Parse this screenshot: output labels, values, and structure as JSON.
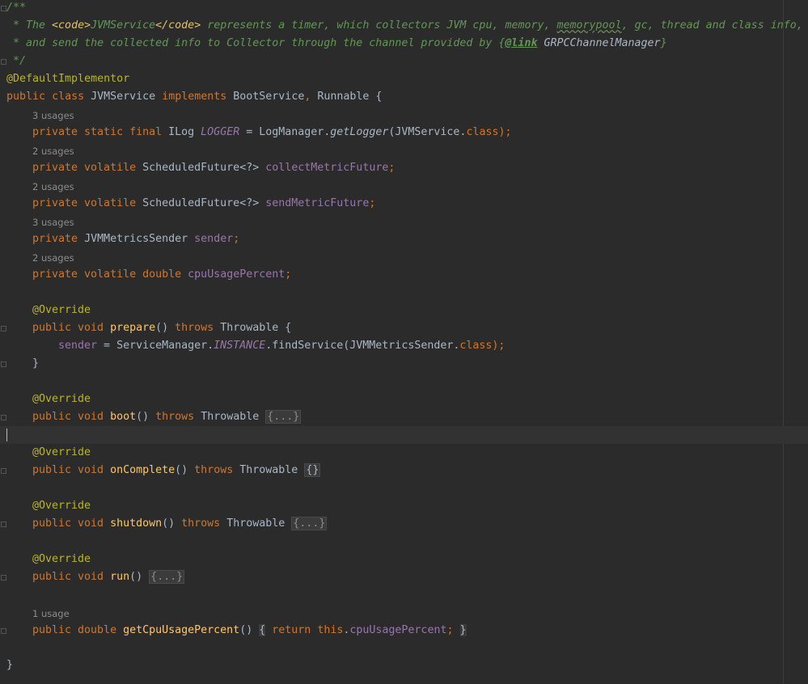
{
  "editor": {
    "comment": {
      "open": "/**",
      "line1_prefix": " * The ",
      "line1_code_open": "<code>",
      "line1_code_text": "JVMService",
      "line1_code_close": "</code>",
      "line1_rest_a": " represents a timer, which collectors JVM cpu, memory, ",
      "line1_typo": "memorypool",
      "line1_rest_b": ", gc, thread and class info,",
      "line2_prefix": " * and send the collected info to Collector through the channel provided by {",
      "line2_tag": "@link",
      "line2_ref": " GRPCChannelManager",
      "line2_suffix": "}",
      "close": " */"
    },
    "annotation_default": "@DefaultImplementor",
    "class_decl": {
      "kw1": "public",
      "kw2": "class",
      "name": "JVMService",
      "kw3": "implements",
      "iface1": "BootService",
      "comma": ",",
      "iface2": "Runnable",
      "brace": " {"
    },
    "fields": [
      {
        "hint": "3 usages",
        "kw": "private static final",
        "type": "ILog",
        "name": "LOGGER",
        "rest_a": " = LogManager.",
        "call": "getLogger",
        "rest_b": "(JVMService.",
        "cls": "class",
        "rest_c": ");"
      },
      {
        "hint": "2 usages",
        "kw": "private volatile",
        "type": "ScheduledFuture<?>",
        "name": "collectMetricFuture",
        "semi": ";"
      },
      {
        "hint": "2 usages",
        "kw": "private volatile",
        "type": "ScheduledFuture<?>",
        "name": "sendMetricFuture",
        "semi": ";"
      },
      {
        "hint": "3 usages",
        "kw": "private",
        "type": "JVMMetricsSender",
        "name": "sender",
        "semi": ";"
      },
      {
        "hint": "2 usages",
        "kw": "private volatile",
        "type": "double",
        "name": "cpuUsagePercent",
        "semi": ";"
      }
    ],
    "override": "@Override",
    "prepare": {
      "kw": "public void",
      "name": "prepare",
      "parens": "()",
      "throws": "throws",
      "exc": "Throwable",
      "brace": " {",
      "body_field": "sender",
      "body_a": " = ServiceManager.",
      "body_instance": "INSTANCE",
      "body_b": ".findService(JVMMetricsSender.",
      "body_cls": "class",
      "body_c": ");",
      "close": "}"
    },
    "boot": {
      "kw": "public void",
      "name": "boot",
      "parens": "()",
      "throws": "throws",
      "exc": "Throwable",
      "folded": "{...}"
    },
    "on_complete": {
      "kw": "public void",
      "name": "onComplete",
      "parens": "()",
      "throws": "throws",
      "exc": "Throwable",
      "folded": "{}"
    },
    "shutdown": {
      "kw": "public void",
      "name": "shutdown",
      "parens": "()",
      "throws": "throws",
      "exc": "Throwable",
      "folded": "{...}"
    },
    "run": {
      "kw": "public void",
      "name": "run",
      "parens": "()",
      "folded": "{...}"
    },
    "getter": {
      "hint": "1 usage",
      "kw": "public double",
      "name": "getCpuUsagePercent",
      "parens": "()",
      "open": "{",
      "ret": "return",
      "this_kw": "this",
      "dot": ".",
      "field": "cpuUsagePercent",
      "semi": ";",
      "close": "}"
    },
    "class_close": "}"
  },
  "colors": {
    "background": "#2b2b2b",
    "keyword": "#cc7832",
    "annotation": "#bbb529",
    "field": "#9876aa",
    "method": "#ffc66d",
    "doc_comment": "#629755",
    "plain": "#a9b7c6",
    "hint": "#8c8c8c"
  }
}
